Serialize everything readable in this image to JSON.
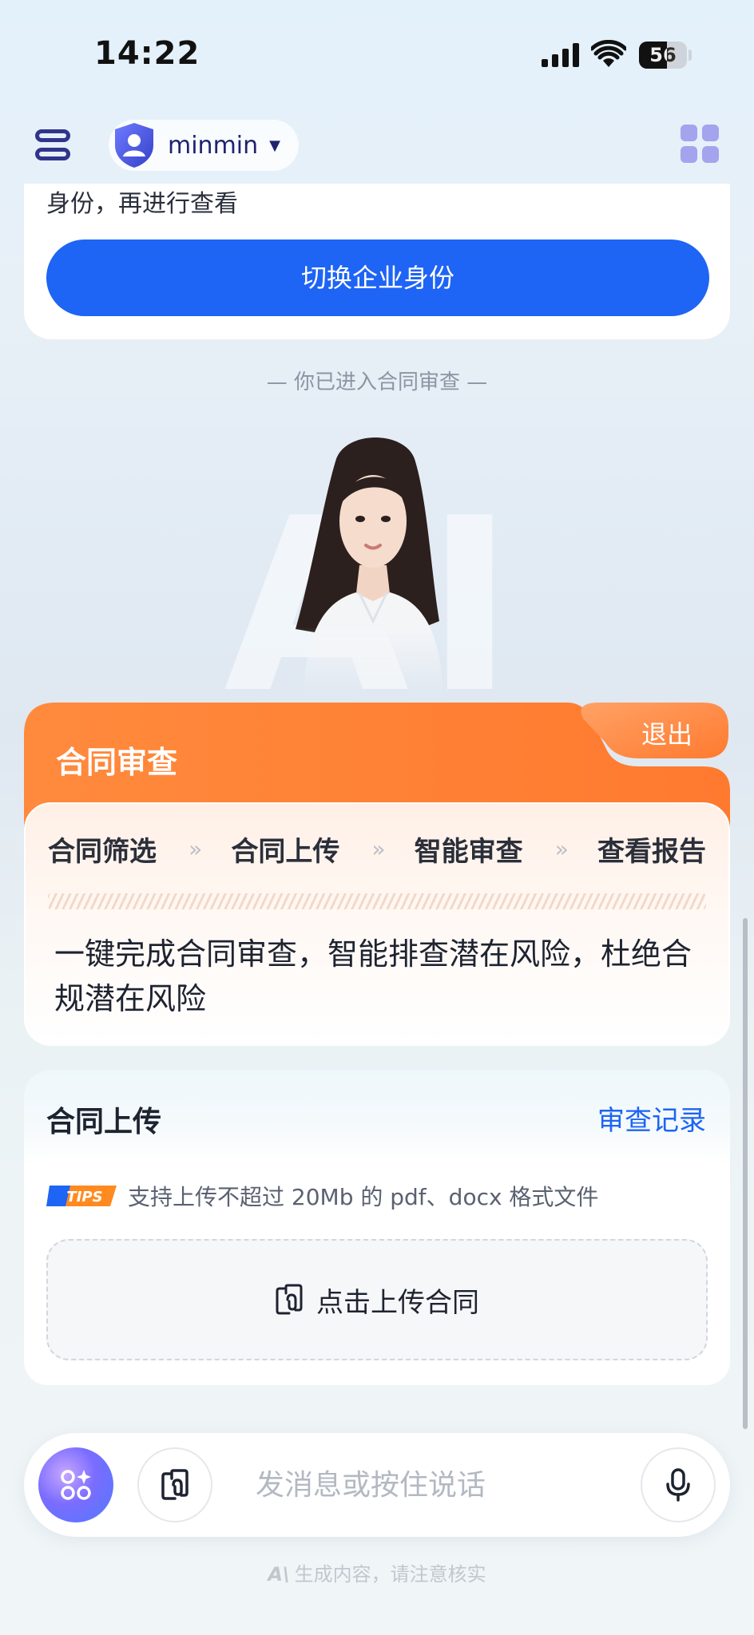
{
  "status_bar": {
    "time": "14:22",
    "battery": "56"
  },
  "header": {
    "username": "minmin"
  },
  "top_card": {
    "text": "身份，再进行查看",
    "switch_button": "切换企业身份"
  },
  "entered_notice": "— 你已进入合同审查 —",
  "watermark": "AI",
  "module": {
    "title": "合同审查",
    "exit_label": "退出",
    "steps": [
      "合同筛选",
      "合同上传",
      "智能审查",
      "查看报告"
    ],
    "separator": "»",
    "description": "一键完成合同审查，智能排查潜在风险，杜绝合规潜在风险"
  },
  "upload": {
    "title": "合同上传",
    "record_link": "审查记录",
    "tips_badge": "TIPS",
    "tips_text": "支持上传不超过 20Mb 的 pdf、docx 格式文件",
    "button_label": "点击上传合同"
  },
  "input_bar": {
    "placeholder": "发消息或按住说话"
  },
  "disclaimer": "生成内容，请注意核实",
  "colors": {
    "primary_blue": "#1e64f5",
    "orange": "#ff7a2f",
    "navy": "#31358a"
  },
  "icons": [
    "menu-icon",
    "shield-user-icon",
    "apps-grid-icon",
    "attach-icon",
    "ai-sparkle-icon",
    "mic-icon"
  ]
}
